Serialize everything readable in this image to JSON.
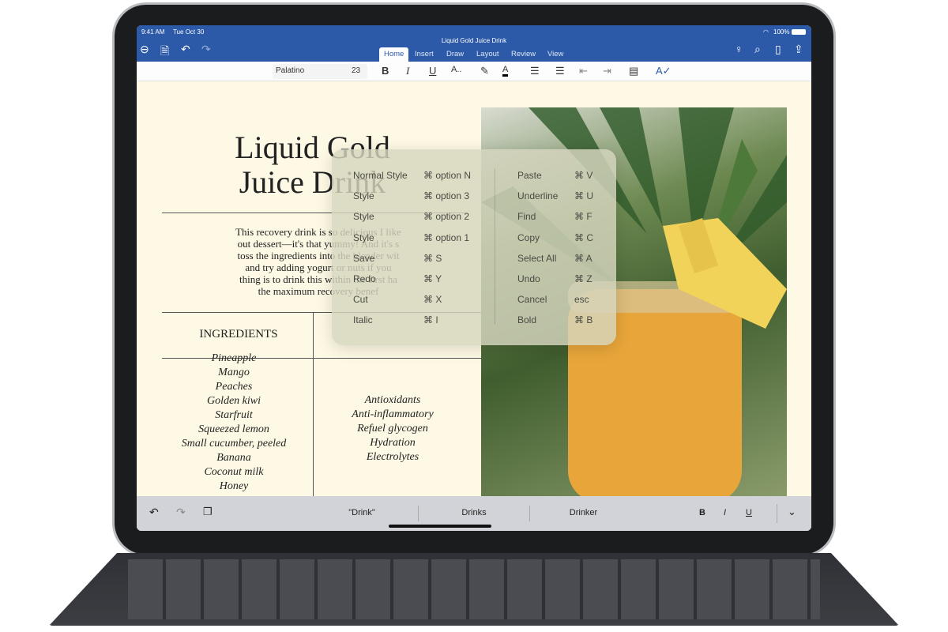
{
  "status": {
    "time": "9:41 AM",
    "date": "Tue Oct 30",
    "battery": "100%"
  },
  "window": {
    "title": "Liquid Gold Juice Drink"
  },
  "tabs": [
    {
      "label": "Home",
      "active": true
    },
    {
      "label": "Insert"
    },
    {
      "label": "Draw"
    },
    {
      "label": "Layout"
    },
    {
      "label": "Review"
    },
    {
      "label": "View"
    }
  ],
  "toolbar": {
    "font": "Palatino",
    "size": "23",
    "bold": "B",
    "italic": "I",
    "underline": "U",
    "font_style": "A..",
    "font_color": "A"
  },
  "document": {
    "title_line1": "Liquid Gold",
    "title_line2": "Juice Drink",
    "paragraph": [
      "This recovery drink is so delicious I like",
      "out dessert—it's that yummy! And it's s",
      "toss the ingredients into the blender wit",
      "and try adding yogurt or nuts if you",
      "thing is to drink this within the first ha",
      "the maximum recovery benef"
    ],
    "ingredients_header": "INGREDIENTS",
    "ingredients": [
      "Pineapple",
      "Mango",
      "Peaches",
      "Golden kiwi",
      "Starfruit",
      "Squeezed lemon",
      "Small cucumber, peeled",
      "Banana",
      "Coconut milk",
      "Honey"
    ],
    "benefits": [
      "Antioxidants",
      "Anti-inflammatory",
      "Refuel glycogen",
      "Hydration",
      "Electrolytes"
    ]
  },
  "shortcuts": {
    "left": [
      {
        "label": "Normal Style",
        "keys": "⌘ option N"
      },
      {
        "label": "Style",
        "keys": "⌘ option 3"
      },
      {
        "label": "Style",
        "keys": "⌘ option 2"
      },
      {
        "label": "Style",
        "keys": "⌘ option 1"
      },
      {
        "label": "Save",
        "keys": "⌘ S"
      },
      {
        "label": "Redo",
        "keys": "⌘ Y"
      },
      {
        "label": "Cut",
        "keys": "⌘ X"
      },
      {
        "label": "Italic",
        "keys": "⌘ I"
      }
    ],
    "right": [
      {
        "label": "Paste",
        "keys": "⌘ V"
      },
      {
        "label": "Underline",
        "keys": "⌘ U"
      },
      {
        "label": "Find",
        "keys": "⌘ F"
      },
      {
        "label": "Copy",
        "keys": "⌘ C"
      },
      {
        "label": "Select All",
        "keys": "⌘ A"
      },
      {
        "label": "Undo",
        "keys": "⌘ Z"
      },
      {
        "label": "Cancel",
        "keys": "esc"
      },
      {
        "label": "Bold",
        "keys": "⌘ B"
      }
    ]
  },
  "bottombar": {
    "suggestions": [
      "\"Drink\"",
      "Drinks",
      "Drinker"
    ],
    "bold": "B",
    "italic": "I",
    "underline": "U"
  },
  "colors": {
    "ribbon": "#2c5aa8",
    "page": "#fdf9e4"
  }
}
